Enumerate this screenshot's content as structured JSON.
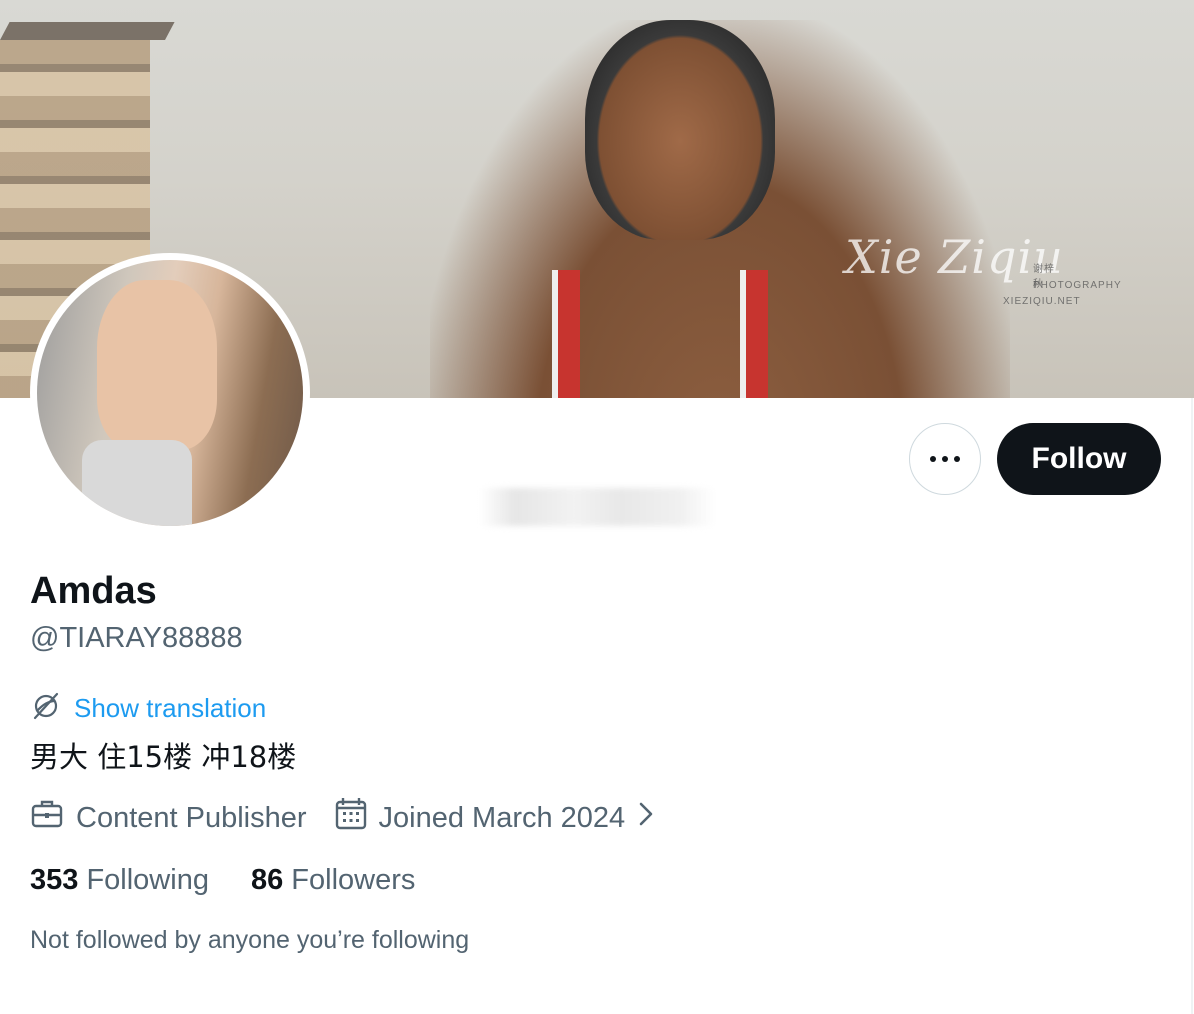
{
  "banner": {
    "watermark_name": "Xie Ziqiu",
    "watermark_cn": "谢梓秋",
    "watermark_sub": "PHOTOGRAPHY",
    "watermark_url": "XIEZIQIU.NET"
  },
  "profile": {
    "name": "Amdas",
    "handle": "@TIARAY88888",
    "translate_label": "Show translation",
    "bio": "男大 住15楼 冲18楼",
    "category": "Content Publisher",
    "joined": "Joined March 2024",
    "following_count": "353",
    "following_label": "Following",
    "followers_count": "86",
    "followers_label": "Followers",
    "not_followed_text": "Not followed by anyone you’re following"
  },
  "actions": {
    "follow_label": "Follow"
  },
  "icons": {
    "translate": "globe-slash-icon",
    "category": "briefcase-icon",
    "joined": "calendar-icon",
    "more": "more-dots-icon",
    "chevron": "chevron-right-icon"
  },
  "colors": {
    "link": "#1d9bf0",
    "secondary_text": "#536471",
    "primary_text": "#0f1419",
    "follow_button": "#0f1419"
  }
}
